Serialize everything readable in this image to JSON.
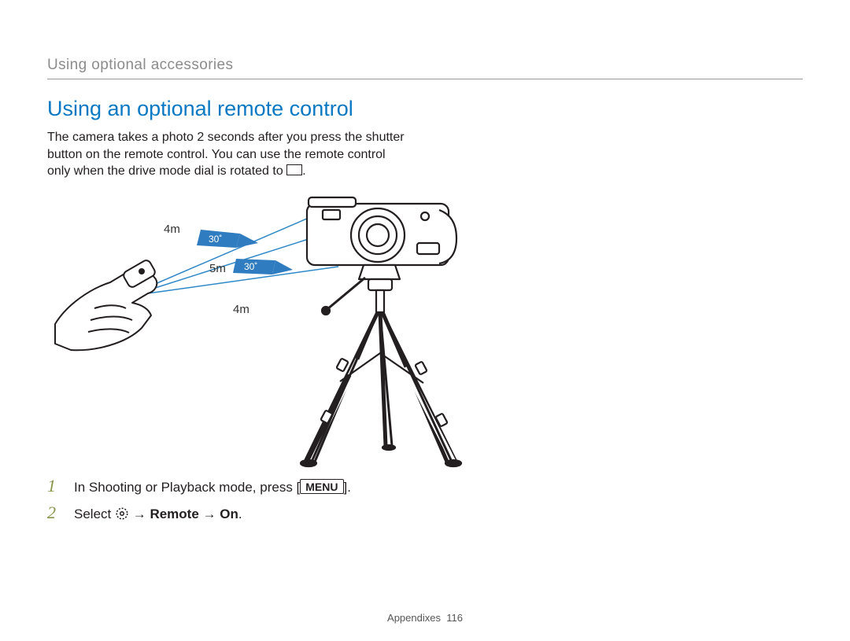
{
  "breadcrumb": "Using optional accessories",
  "section_title": "Using an optional remote control",
  "intro_line1": "The camera takes a photo 2 seconds after you press the shutter",
  "intro_line2": "button on the remote control. You can use the remote control",
  "intro_line3_prefix": "only when the drive mode dial is rotated to ",
  "intro_line3_suffix": ".",
  "figure": {
    "dist_top": "4m",
    "dist_mid": "5m",
    "dist_bottom": "4m",
    "angle_top": "30˚",
    "angle_bottom": "30˚"
  },
  "steps": {
    "s1_num": "1",
    "s1_prefix": "In Shooting or Playback mode, press [",
    "s1_menu": "MENU",
    "s1_suffix": "].",
    "s2_num": "2",
    "s2_prefix": "Select ",
    "s2_arrow1": " → ",
    "s2_remote": "Remote",
    "s2_arrow2": " → ",
    "s2_on": "On",
    "s2_suffix": "."
  },
  "footer": {
    "section": "Appendixes",
    "page": "116"
  }
}
